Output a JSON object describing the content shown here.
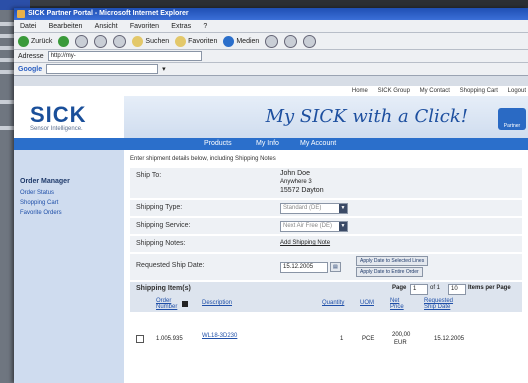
{
  "browser": {
    "title": "SICK Partner Portal - Microsoft Internet Explorer",
    "menu": [
      "Datei",
      "Bearbeiten",
      "Ansicht",
      "Favoriten",
      "Extras",
      "?"
    ],
    "toolbar": {
      "back": "Zurück",
      "search": "Suchen",
      "favorites": "Favoriten",
      "media": "Medien"
    },
    "address_label": "Adresse",
    "address_value": "http://my-sick.sick.de/shop/partnerportal/TopFrameset.aspx",
    "google_label": "Google"
  },
  "page": {
    "toplinks": [
      "Home",
      "SICK Group",
      "My Contact",
      "Shopping Cart",
      "Logout"
    ],
    "logo": "SICK",
    "logo_sub": "Sensor Intelligence.",
    "banner_text": "My SICK with a Click!",
    "partner_label": "Partner Portal",
    "nav": [
      "Products",
      "My Info",
      "My Account"
    ],
    "sidebar": {
      "heading": "Order Manager",
      "items": [
        "Order Status",
        "Shopping Cart",
        "Favorite Orders"
      ]
    },
    "intro": "Enter shipment details below, including Shipping Notes",
    "ship_to_label": "Ship To:",
    "ship_to": [
      "John Doe",
      "Anywhere 3",
      "15572 Dayton"
    ],
    "shipping_type_label": "Shipping Type:",
    "shipping_type_value": "Standard (DE)",
    "shipping_service_label": "Shipping Service:",
    "shipping_service_value": "Next Air Free (DE)",
    "shipping_notes_label": "Shipping Notes:",
    "shipping_notes_link": "Add Shipping Note",
    "requested_date_label": "Requested Ship Date:",
    "requested_date_value": "15.12.2005",
    "apply_selected": "Apply Date to Selected Lines",
    "apply_all": "Apply Date to Entire Order",
    "shipping_items_label": "Shipping Item(s)",
    "page_label": "Page",
    "page_value": "1",
    "page_of": "of 1",
    "items_per_page_value": "10",
    "items_per_page_label": "Items per Page",
    "columns": [
      "Order Number",
      "Description",
      "Quantity",
      "UOM",
      "Net Price",
      "Requested Ship Date"
    ],
    "row": {
      "part": "1.005.935",
      "desc": "WL18-3D230",
      "qty": "1",
      "uom": "PCE",
      "price": "200,00",
      "price2": "EUR",
      "date": "15.12.2005"
    }
  }
}
